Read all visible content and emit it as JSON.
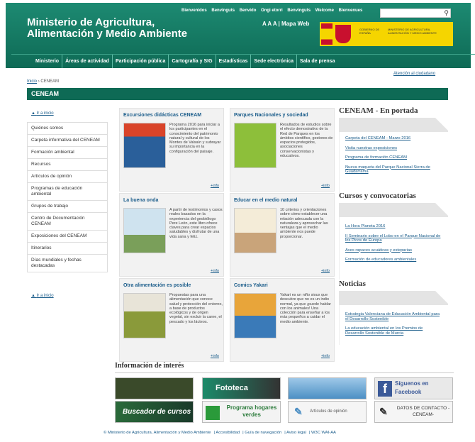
{
  "header": {
    "title_line1": "Ministerio de Agricultura,",
    "title_line2": "Alimentación y Medio Ambiente",
    "top_links": [
      "Bienvenidos",
      "Benvinguts",
      "Benvido",
      "Ongi etorri",
      "Benvinguts",
      "Welcome",
      "Bienvenues"
    ],
    "access": "A A A | Mapa Web",
    "gov_text1": "GOBIERNO DE ESPAÑA",
    "gov_text2": "MINISTERIO DE AGRICULTURA, ALIMENTACIÓN Y MEDIO AMBIENTE",
    "search_placeholder": ""
  },
  "nav": [
    "Ministerio",
    "Áreas de actividad",
    "Participación pública",
    "Cartografía y SIG",
    "Estadísticas",
    "Sede electrónica",
    "Sala de prensa"
  ],
  "citizen_link": "Atención al ciudadano",
  "breadcrumb": {
    "home": "Inicio",
    "current": "CENEAM"
  },
  "section_title": "CENEAM",
  "goup_label": "Ir a inicio",
  "sidebar": [
    "Quiénes somos",
    "Carpeta informativa del CENEAM",
    "Formación ambiental",
    "Recursos",
    "Artículos de opinión",
    "Programas de educación ambiental",
    "Grupos de trabajo",
    "Centro de Documentación CENEAM",
    "Exposiciones del CENEAM",
    "Itinerarios",
    "Días mundiales y fechas destacadas"
  ],
  "cards": [
    {
      "title": "Excursiones didácticas CENEAM",
      "text": "Programa 2016 para iniciar a los participantes en el conocimiento del patrimonio natural y cultural de los Montes de Valsaín y subrayar su importancia en la configuración del paisaje.",
      "more": "+info",
      "img_color": "#d9442a"
    },
    {
      "title": "Parques Nacionales y sociedad",
      "text": "Resultados de estudios sobre el efecto demostrativo de la Red de Parques en los ámbitos científico, gestores de espacios protegidos, asociaciones conservacionistas y educativos.",
      "more": "+info",
      "img_color": "#8dbf3a"
    },
    {
      "title": "La buena onda",
      "text": "A partir de testimonios y casos reales basados en la experiencia del geobiólogo Pere León, este libro ofrece claves para crear espacios saludables y disfrutar de una vida sana y feliz.",
      "more": "+info",
      "img_color": "#cfe3ef"
    },
    {
      "title": "Educar en el medio natural",
      "text": "10 criterios y orientaciones sobre cómo establecer una relación adecuada con la naturaleza y aprovechar las ventajas que el medio ambiente nos puede proporcionar.",
      "more": "+info",
      "img_color": "#f4ecd8"
    },
    {
      "title": "Otra alimentación es posible",
      "text": "Propuestas para una alimentación que conoce salud y protección del entorno, a base de productos ecológicos y de origen vegetal, sin excluir la carne, el pescado y los lácteos.",
      "more": "+info",
      "img_color": "#8a9a3a"
    },
    {
      "title": "Comics Yakari",
      "text": "Yakari es un niño sioux que descubre que no es un indio normal, ya que ¡puede hablar con los animales! Una colección para enseñar a los más pequeños a cuidar el medio ambiente.",
      "more": "+info",
      "img_color": "#e8a53a"
    }
  ],
  "right": {
    "portada_title": "CENEAM - En portada",
    "portada_links": [
      "Carpeta del CENEAM - Marzo 2016",
      "Visita nuestras exposiciones",
      "Programa de formación CENEAM",
      "Nueva maqueta del Parque Nacional Sierra de Guadarrama"
    ],
    "cursos_title": "Cursos y convocatorias",
    "cursos_links": [
      "La Hora Planeta 2016",
      "II Seminario sobre el Lobo en el Parque Nacional de los Picos de Europa",
      "Aves rapaces acuáticas y esteparias",
      "Formación de educadores ambientales"
    ],
    "noticias_title": "Noticias",
    "noticias_links": [
      "Estrategia Valenciana de Educación Ambiental para el Desarrollo Sostenible",
      "La educación ambiental en los Premios de Desarrollo Sostenible de Murcia"
    ]
  },
  "info": {
    "title": "Información de interés",
    "tiles": [
      {
        "label": "",
        "bg": "#3a4a2a",
        "color": "#fff"
      },
      {
        "label": "Fototeca",
        "bg": "#1c8a6a",
        "color": "#fff"
      },
      {
        "label": "",
        "bg": "#4c8fc4",
        "color": "#fff"
      },
      {
        "label": "Síguenos en Facebook",
        "bg": "#e9e9e9",
        "color": "#3b5998"
      },
      {
        "label": "Buscador de cursos",
        "bg": "#2a6a3a",
        "color": "#fff"
      },
      {
        "label": "Programa hogares verdes",
        "bg": "#f3f3f3",
        "color": "#2a7a3a"
      },
      {
        "label": "Artículos de opinión",
        "bg": "#f5f5f5",
        "color": "#555"
      },
      {
        "label": "DATOS DE CONTACTO -CENEAM-",
        "bg": "#f5f5f5",
        "color": "#333"
      }
    ]
  },
  "footer": [
    "© Ministerio de Agricultura, Alimentación y Medio Ambiente",
    "| Accesibilidad",
    "| Guía de navegación",
    "| Aviso legal",
    "| W3C WAI-AA"
  ]
}
